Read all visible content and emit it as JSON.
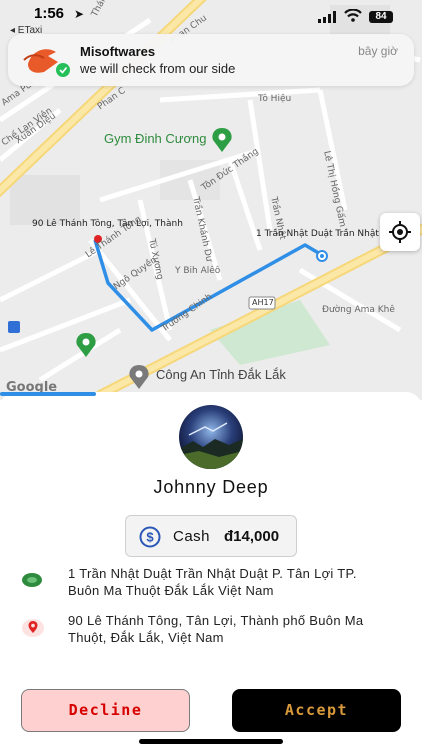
{
  "status_bar": {
    "time": "1:56",
    "back_app": "◂ ETaxi",
    "battery": "84"
  },
  "notification": {
    "app": "Misoftwares",
    "message": "we will check from our side",
    "time": "bây giờ"
  },
  "map": {
    "street_labels": [
      "Thái Học",
      "Phan Chu",
      "Phan C",
      "Ama Pui",
      "Chế Lan Viên",
      "Xuân Diệu",
      "Tô Hiệu",
      "Tôn Đức Thắng",
      "Lê Thị Hồng Gấm",
      "Trần Khánh Dư",
      "Trần Nhật",
      "Tú Xương",
      "Y Bih Alêô",
      "Ngô Quyền",
      "Lê Thánh Tông",
      "Trường Chinh",
      "Đường Ama Khê",
      "AH17"
    ],
    "pois": {
      "gym": "Gym Đinh Cương",
      "police": "Công An Tỉnh Đắk Lắk"
    },
    "pickup_label": "1 Trần Nhật Duật Trần Nhật",
    "dropoff_label": "90 Lê Thánh Tông, Tân Lợi, Thành",
    "attribution": "Google",
    "route_color": "#2f8ee5"
  },
  "driver": {
    "name": "Johnny Deep"
  },
  "fare": {
    "method": "Cash",
    "amount": "đ14,000"
  },
  "pickup": {
    "address": "1 Trần Nhật Duật Trần Nhật Duật P. Tân Lợi TP. Buôn Ma Thuột Đắk Lắk Việt Nam"
  },
  "dropoff": {
    "address": "90 Lê Thánh Tông, Tân Lợi, Thành phố Buôn Ma Thuột, Đắk Lắk, Việt Nam"
  },
  "actions": {
    "decline": "Decline",
    "accept": "Accept"
  },
  "colors": {
    "accent": "#2f8ee5",
    "decline_bg": "#ffd0d0",
    "decline_text": "#d60000",
    "accept_bg": "#000000",
    "accept_text": "#d99a3c",
    "pickup_icon": "#2e8b3d",
    "dropoff_icon": "#e02424"
  }
}
